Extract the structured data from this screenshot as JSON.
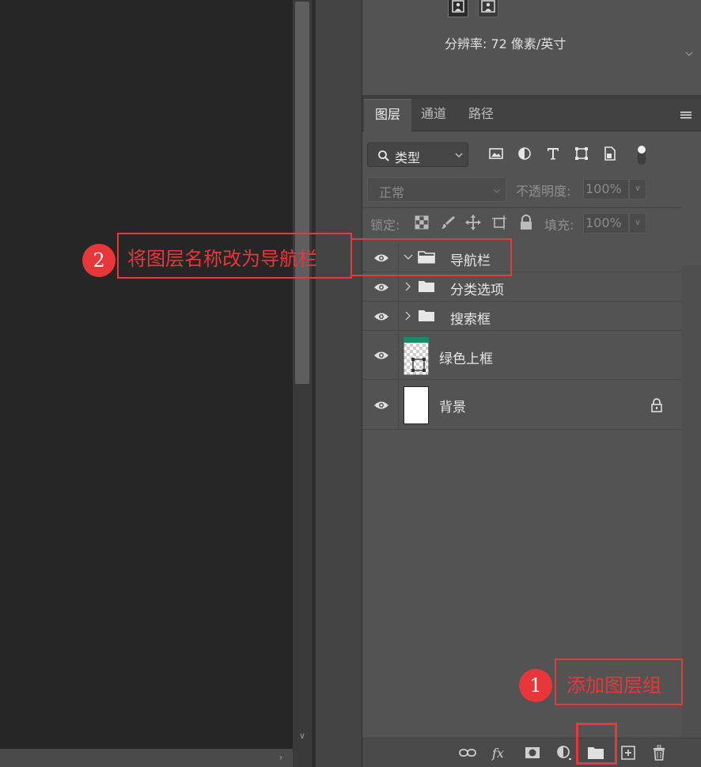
{
  "properties": {
    "resolution_label": "分辨率: 72 像素/英寸"
  },
  "tabs": [
    {
      "label": "图层",
      "active": true
    },
    {
      "label": "通道",
      "active": false
    },
    {
      "label": "路径",
      "active": false
    }
  ],
  "filter": {
    "kind_label": "类型"
  },
  "blend": {
    "mode": "正常",
    "opacity_label": "不透明度:",
    "opacity_value": "100%"
  },
  "lock": {
    "label": "锁定:",
    "fill_label": "填充:",
    "fill_value": "100%"
  },
  "layers": [
    {
      "name": "导航栏",
      "type": "group",
      "expanded": true
    },
    {
      "name": "分类选项",
      "type": "group",
      "expanded": false
    },
    {
      "name": "搜索框",
      "type": "group",
      "expanded": false
    },
    {
      "name": "绿色上框",
      "type": "shape"
    },
    {
      "name": "背景",
      "type": "background",
      "locked": true
    }
  ],
  "annotations": [
    {
      "number": "1",
      "text": "添加图层组"
    },
    {
      "number": "2",
      "text": "将图层名称改为导航栏"
    }
  ],
  "colors": {
    "annotation_red": "#e8373a",
    "panel_bg": "#535353",
    "canvas_bg": "#262626"
  }
}
